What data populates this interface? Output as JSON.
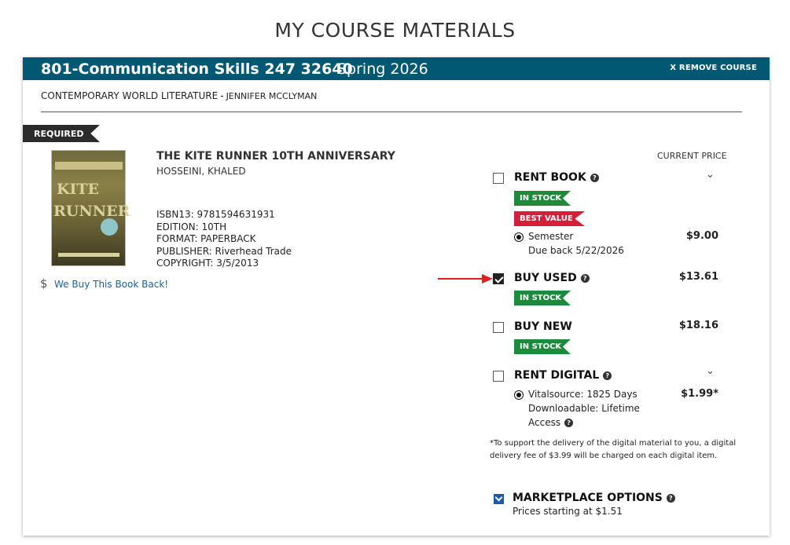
{
  "page": {
    "title": "MY COURSE MATERIALS"
  },
  "course": {
    "code": "801-Communication Skills 247 32640",
    "term": "Spring 2026",
    "remove_label": "X REMOVE COURSE",
    "subtitle_course": "CONTEMPORARY WORLD LITERATURE",
    "subtitle_sep": "-",
    "instructor": "JENNIFER MCCLYMAN"
  },
  "item": {
    "requirement": "REQUIRED",
    "title": "THE KITE RUNNER 10TH ANNIVERSARY",
    "author": "HOSSEINI, KHALED",
    "isbn": "ISBN13: 9781594631931",
    "edition": "EDITION: 10TH",
    "format": "FORMAT: PAPERBACK",
    "publisher": "PUBLISHER: Riverhead Trade",
    "copyright": "COPYRIGHT: 3/5/2013",
    "buyback_label": "We Buy This Book Back!",
    "buyback_icon": "dollar-icon"
  },
  "pricing": {
    "header": "CURRENT PRICE",
    "rent_book": {
      "label": "RENT BOOK",
      "checked": false,
      "badge_stock": "IN STOCK",
      "badge_value": "BEST VALUE",
      "option_label": "Semester",
      "due": "Due back 5/22/2026",
      "price": "$9.00"
    },
    "buy_used": {
      "label": "BUY USED",
      "checked": true,
      "badge_stock": "IN STOCK",
      "price": "$13.61"
    },
    "buy_new": {
      "label": "BUY NEW",
      "checked": false,
      "badge_stock": "IN STOCK",
      "price": "$18.16"
    },
    "rent_digital": {
      "label": "RENT DIGITAL",
      "checked": false,
      "option_line1": "Vitalsource: 1825 Days",
      "option_line2": "Downloadable: Lifetime",
      "option_line3": "Access",
      "price": "$1.99*"
    },
    "note": "*To support the delivery of the digital material to you, a digital delivery fee of $3.99 will be charged on each digital item.",
    "marketplace": {
      "label": "MARKETPLACE OPTIONS",
      "sub": "Prices starting at $1.51"
    }
  },
  "colors": {
    "course_bar": "#005872",
    "in_stock": "#1e8a3c",
    "best_value": "#d41f3a",
    "link": "#1a5f9c",
    "annotation_arrow": "#e02020"
  }
}
